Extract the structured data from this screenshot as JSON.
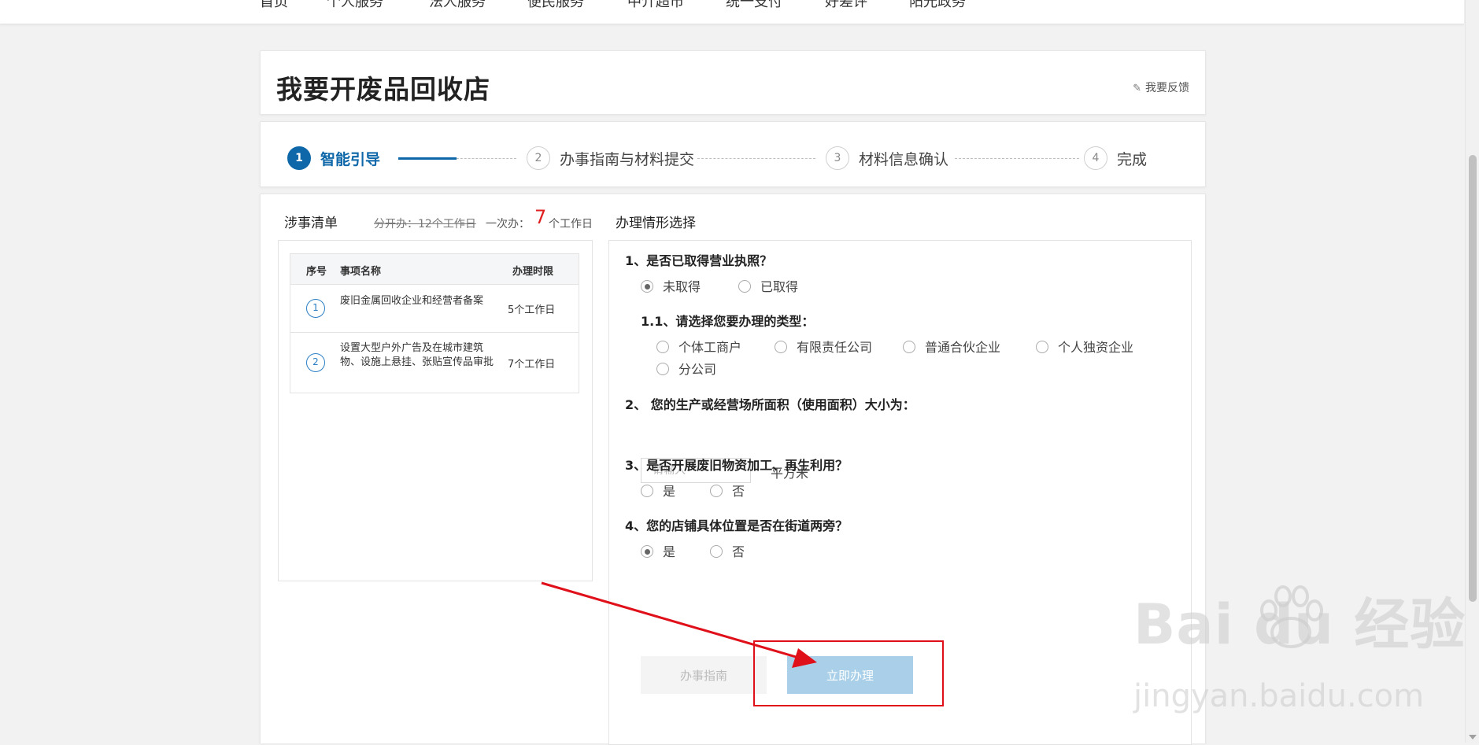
{
  "top_nav": [
    "首页",
    "个人服务",
    "法人服务",
    "便民服务",
    "中介超市",
    "统一支付",
    "好差评",
    "阳光政务"
  ],
  "page": {
    "title": "我要开废品回收店",
    "feedback_label": "我要反馈"
  },
  "steps": [
    {
      "num": "1",
      "label": "智能引导",
      "active": true
    },
    {
      "num": "2",
      "label": "办事指南与材料提交",
      "active": false
    },
    {
      "num": "3",
      "label": "材料信息确认",
      "active": false
    },
    {
      "num": "4",
      "label": "完成",
      "active": false
    }
  ],
  "item_list": {
    "title": "涉事清单",
    "separate_time": "分开办：12个工作日",
    "once_label": "一次办：",
    "once_days": "7",
    "once_unit": "个工作日",
    "columns": [
      "序号",
      "事项名称",
      "办理时限"
    ],
    "rows": [
      {
        "idx": "①",
        "name": "废旧金属回收企业和经营者备案",
        "limit": "5个工作日"
      },
      {
        "idx": "②",
        "name": "设置大型户外广告及在城市建筑物、设施上悬挂、张贴宣传品审批",
        "limit": "7个工作日"
      }
    ]
  },
  "situation": {
    "title": "办理情形选择",
    "q1": {
      "label": "1、是否已取得营业执照？",
      "options": [
        "未取得",
        "已取得"
      ],
      "selected": "未取得"
    },
    "q1_1": {
      "label": "1.1、请选择您要办理的类型：",
      "options": [
        "个体工商户",
        "有限责任公司",
        "普通合伙企业",
        "个人独资企业",
        "分公司"
      ],
      "selected": ""
    },
    "q2": {
      "label": "2、 您的生产或经营场所面积（使用面积）大小为：",
      "placeholder": "请输入",
      "value": "",
      "unit": "平方米"
    },
    "q3": {
      "label": "3、是否开展废旧物资加工、再生利用？",
      "options": [
        "是",
        "否"
      ],
      "selected": ""
    },
    "q4": {
      "label": "4、您的店铺具体位置是否在街道两旁？",
      "options": [
        "是",
        "否"
      ],
      "selected": "是"
    },
    "buttons": {
      "guide": "办事指南",
      "submit": "立即办理"
    }
  },
  "colors": {
    "primary": "#0d67a8",
    "annotation": "#e0101a",
    "submit_bg": "#a9d0e8",
    "highlight_number": "#e02020"
  },
  "watermark": {
    "text": "Bai du 经验",
    "sub": "jingyan.baidu.com"
  }
}
